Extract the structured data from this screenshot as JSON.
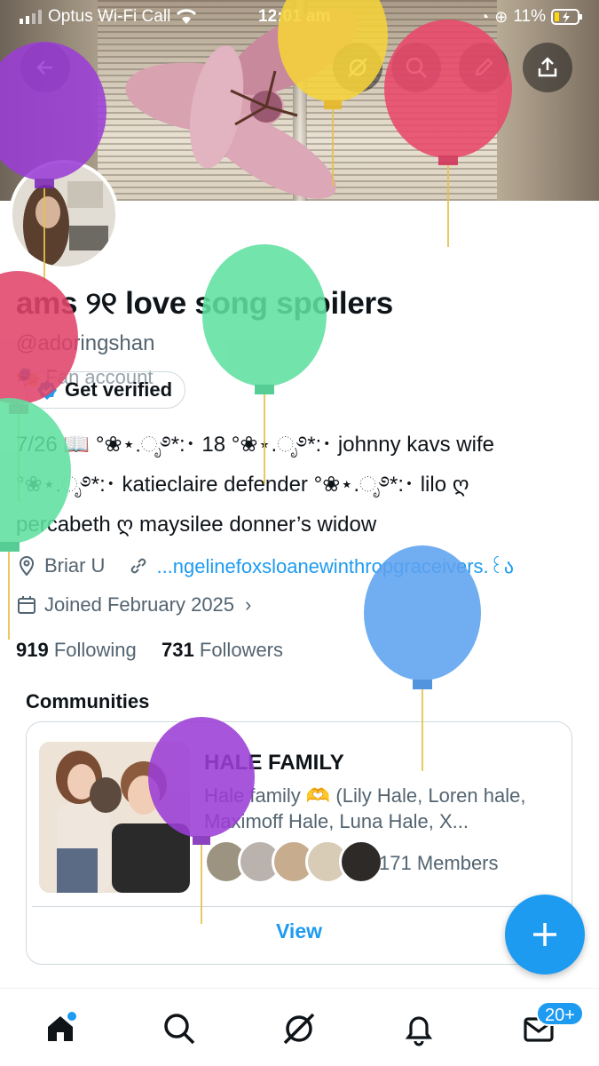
{
  "status_bar": {
    "carrier": "Optus Wi-Fi Call",
    "time": "12:01 am",
    "battery": "11%"
  },
  "profile": {
    "display_name": "ams ୨୧ love song spoilers",
    "handle": "@adoringshan",
    "category": "Fan account",
    "verify_label": "Get verified",
    "bio_lines": [
      "7/26 📖 °❀⋆.ೃ࿔*:･ 18 °❀⋆.ೃ࿔*:･ johnny kavs wife",
      "°❀⋆.ೃ࿔*:･ katieclaire defender °❀⋆.ೃ࿔*:･ lilo ღ",
      "percabeth ღ maysilee donner’s widow"
    ],
    "location": "Briar U",
    "link": "...ngelinefoxsloanewinthropgraceivers.꒰ა",
    "joined": "Joined February 2025",
    "following_count": "919",
    "following_label": "Following",
    "followers_count": "731",
    "followers_label": "Followers"
  },
  "communities": {
    "section_title": "Communities",
    "card": {
      "name": "HALE FAMILY",
      "description": "Hale family 🫶 (Lily Hale, Loren hale, Maximoff Hale, Luna Hale, X...",
      "members": "171 Members",
      "view_label": "View"
    }
  },
  "colors": {
    "accent": "#1d9bf0",
    "text": "#0f1419",
    "muted": "#536471",
    "border": "#cfd9de"
  },
  "tabbar": {
    "items": [
      "home-icon",
      "search-icon",
      "grok-icon",
      "notifications-icon",
      "messages-icon"
    ],
    "messages_badge": "20+"
  }
}
